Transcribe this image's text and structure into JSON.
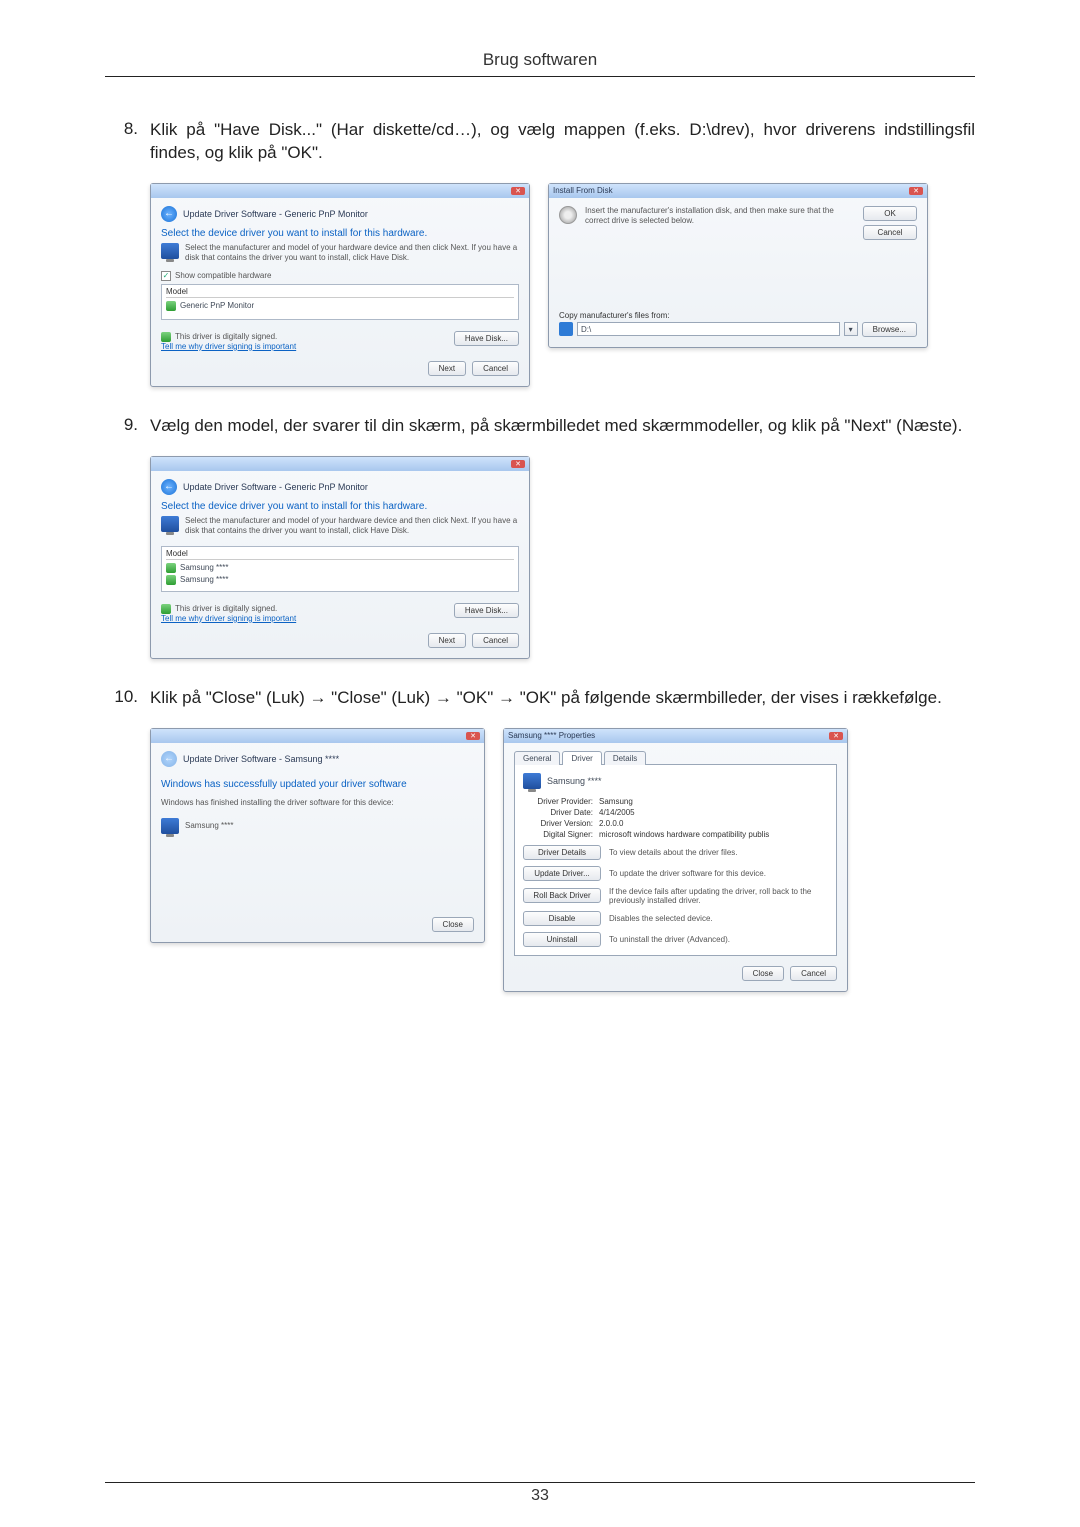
{
  "header": {
    "title": "Brug softwaren"
  },
  "footer": {
    "page_number": "33"
  },
  "steps": {
    "s8": {
      "num": "8.",
      "text": "Klik på \"Have Disk...\" (Har diskette/cd…), og vælg mappen (f.eks. D:\\drev), hvor driverens indstillingsfil findes, og klik på \"OK\"."
    },
    "s9": {
      "num": "9.",
      "text": "Vælg den model, der svarer til din skærm, på skærmbilledet med skærmmodeller, og klik på \"Next\" (Næste)."
    },
    "s10": {
      "num": "10.",
      "text": "Klik på \"Close\" (Luk) → \"Close\" (Luk) → \"OK\" → \"OK\" på følgende skærmbilleder, der vises i rækkefølge."
    }
  },
  "dlg_update1": {
    "nav_title": "Update Driver Software - Generic PnP Monitor",
    "section": "Select the device driver you want to install for this hardware.",
    "sub": "Select the manufacturer and model of your hardware device and then click Next. If you have a disk that contains the driver you want to install, click Have Disk.",
    "show_compat": "Show compatible hardware",
    "model_hdr": "Model",
    "model_item": "Generic PnP Monitor",
    "signed": "This driver is digitally signed.",
    "signed_link": "Tell me why driver signing is important",
    "have_disk": "Have Disk...",
    "next": "Next",
    "cancel": "Cancel"
  },
  "dlg_install": {
    "title": "Install From Disk",
    "msg": "Insert the manufacturer's installation disk, and then make sure that the correct drive is selected below.",
    "ok": "OK",
    "cancel": "Cancel",
    "copy_label": "Copy manufacturer's files from:",
    "path": "D:\\",
    "browse": "Browse..."
  },
  "dlg_update2": {
    "nav_title": "Update Driver Software - Generic PnP Monitor",
    "section": "Select the device driver you want to install for this hardware.",
    "sub": "Select the manufacturer and model of your hardware device and then click Next. If you have a disk that contains the driver you want to install, click Have Disk.",
    "model_hdr": "Model",
    "model_item1": "Samsung ****",
    "model_item2": "Samsung ****",
    "signed": "This driver is digitally signed.",
    "signed_link": "Tell me why driver signing is important",
    "have_disk": "Have Disk...",
    "next": "Next",
    "cancel": "Cancel"
  },
  "dlg_success": {
    "nav_title": "Update Driver Software - Samsung ****",
    "section": "Windows has successfully updated your driver software",
    "sub": "Windows has finished installing the driver software for this device:",
    "device": "Samsung ****",
    "close": "Close"
  },
  "dlg_props": {
    "title": "Samsung **** Properties",
    "tab_general": "General",
    "tab_driver": "Driver",
    "tab_details": "Details",
    "device_name": "Samsung ****",
    "provider_k": "Driver Provider:",
    "provider_v": "Samsung",
    "date_k": "Driver Date:",
    "date_v": "4/14/2005",
    "version_k": "Driver Version:",
    "version_v": "2.0.0.0",
    "signer_k": "Digital Signer:",
    "signer_v": "microsoft windows hardware compatibility publis",
    "btn_details": "Driver Details",
    "desc_details": "To view details about the driver files.",
    "btn_update": "Update Driver...",
    "desc_update": "To update the driver software for this device.",
    "btn_rollback": "Roll Back Driver",
    "desc_rollback": "If the device fails after updating the driver, roll back to the previously installed driver.",
    "btn_disable": "Disable",
    "desc_disable": "Disables the selected device.",
    "btn_uninstall": "Uninstall",
    "desc_uninstall": "To uninstall the driver (Advanced).",
    "close": "Close",
    "cancel": "Cancel"
  }
}
